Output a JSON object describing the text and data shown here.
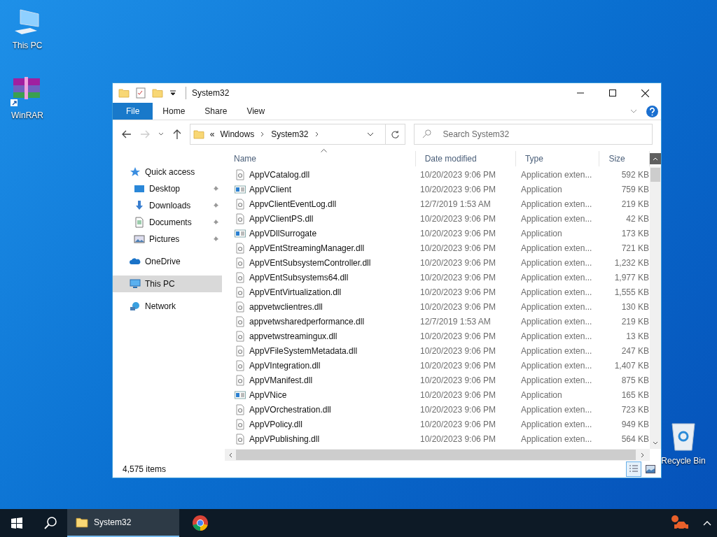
{
  "desktop_icons": [
    {
      "label": "This PC",
      "kind": "pc"
    },
    {
      "label": "WinRAR",
      "kind": "archive"
    }
  ],
  "recycle_bin": {
    "label": "Recycle Bin"
  },
  "window": {
    "title": "System32"
  },
  "ribbon_tabs": [
    {
      "label": "File",
      "selected": true
    },
    {
      "label": "Home",
      "selected": false
    },
    {
      "label": "Share",
      "selected": false
    },
    {
      "label": "View",
      "selected": false
    }
  ],
  "address": {
    "overflow": "«",
    "crumbs": [
      "Windows",
      "System32"
    ]
  },
  "search": {
    "placeholder": "Search System32"
  },
  "nav": [
    {
      "label": "Quick access",
      "kind": "quick",
      "selected": false,
      "pinned": false
    },
    {
      "label": "Desktop",
      "kind": "desktop",
      "selected": false,
      "pinned": true
    },
    {
      "label": "Downloads",
      "kind": "downloads",
      "selected": false,
      "pinned": true
    },
    {
      "label": "Documents",
      "kind": "documents",
      "selected": false,
      "pinned": true
    },
    {
      "label": "Pictures",
      "kind": "pictures",
      "selected": false,
      "pinned": true
    },
    {
      "label": "OneDrive",
      "kind": "cloud",
      "selected": false,
      "pinned": false
    },
    {
      "label": "This PC",
      "kind": "pc",
      "selected": true,
      "pinned": false
    },
    {
      "label": "Network",
      "kind": "network",
      "selected": false,
      "pinned": false
    }
  ],
  "columns": [
    "Name",
    "Date modified",
    "Type",
    "Size"
  ],
  "files": [
    {
      "name": "AppVCatalog.dll",
      "kind": "dll",
      "date": "10/20/2023 9:06 PM",
      "type": "Application exten...",
      "size": "592 KB"
    },
    {
      "name": "AppVClient",
      "kind": "app",
      "date": "10/20/2023 9:06 PM",
      "type": "Application",
      "size": "759 KB"
    },
    {
      "name": "AppvClientEventLog.dll",
      "kind": "dll",
      "date": "12/7/2019 1:53 AM",
      "type": "Application exten...",
      "size": "219 KB"
    },
    {
      "name": "AppVClientPS.dll",
      "kind": "dll",
      "date": "10/20/2023 9:06 PM",
      "type": "Application exten...",
      "size": "42 KB"
    },
    {
      "name": "AppVDllSurrogate",
      "kind": "app",
      "date": "10/20/2023 9:06 PM",
      "type": "Application",
      "size": "173 KB"
    },
    {
      "name": "AppVEntStreamingManager.dll",
      "kind": "dll",
      "date": "10/20/2023 9:06 PM",
      "type": "Application exten...",
      "size": "721 KB"
    },
    {
      "name": "AppVEntSubsystemController.dll",
      "kind": "dll",
      "date": "10/20/2023 9:06 PM",
      "type": "Application exten...",
      "size": "1,232 KB"
    },
    {
      "name": "AppVEntSubsystems64.dll",
      "kind": "dll",
      "date": "10/20/2023 9:06 PM",
      "type": "Application exten...",
      "size": "1,977 KB"
    },
    {
      "name": "AppVEntVirtualization.dll",
      "kind": "dll",
      "date": "10/20/2023 9:06 PM",
      "type": "Application exten...",
      "size": "1,555 KB"
    },
    {
      "name": "appvetwclientres.dll",
      "kind": "dll",
      "date": "10/20/2023 9:06 PM",
      "type": "Application exten...",
      "size": "130 KB"
    },
    {
      "name": "appvetwsharedperformance.dll",
      "kind": "dll",
      "date": "12/7/2019 1:53 AM",
      "type": "Application exten...",
      "size": "219 KB"
    },
    {
      "name": "appvetwstreamingux.dll",
      "kind": "dll",
      "date": "10/20/2023 9:06 PM",
      "type": "Application exten...",
      "size": "13 KB"
    },
    {
      "name": "AppVFileSystemMetadata.dll",
      "kind": "dll",
      "date": "10/20/2023 9:06 PM",
      "type": "Application exten...",
      "size": "247 KB"
    },
    {
      "name": "AppVIntegration.dll",
      "kind": "dll",
      "date": "10/20/2023 9:06 PM",
      "type": "Application exten...",
      "size": "1,407 KB"
    },
    {
      "name": "AppVManifest.dll",
      "kind": "dll",
      "date": "10/20/2023 9:06 PM",
      "type": "Application exten...",
      "size": "875 KB"
    },
    {
      "name": "AppVNice",
      "kind": "app",
      "date": "10/20/2023 9:06 PM",
      "type": "Application",
      "size": "165 KB"
    },
    {
      "name": "AppVOrchestration.dll",
      "kind": "dll",
      "date": "10/20/2023 9:06 PM",
      "type": "Application exten...",
      "size": "723 KB"
    },
    {
      "name": "AppVPolicy.dll",
      "kind": "dll",
      "date": "10/20/2023 9:06 PM",
      "type": "Application exten...",
      "size": "949 KB"
    },
    {
      "name": "AppVPublishing.dll",
      "kind": "dll",
      "date": "10/20/2023 9:06 PM",
      "type": "Application exten...",
      "size": "564 KB"
    }
  ],
  "status": {
    "item_count": "4,575 items"
  },
  "view_buttons": [
    {
      "kind": "details",
      "selected": true
    },
    {
      "kind": "large",
      "selected": false
    }
  ],
  "taskbar": {
    "tasks": [
      {
        "label": "System32",
        "selected": true
      }
    ]
  }
}
